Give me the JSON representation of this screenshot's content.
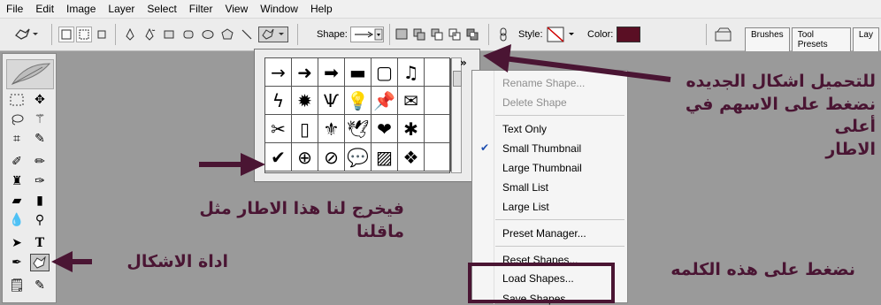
{
  "menubar": {
    "items": [
      "File",
      "Edit",
      "Image",
      "Layer",
      "Select",
      "Filter",
      "View",
      "Window",
      "Help"
    ]
  },
  "options_bar": {
    "shape_label": "Shape:",
    "style_label": "Style:",
    "color_label": "Color:",
    "color_value": "#5a0f24",
    "panel_tabs": [
      "Brushes",
      "Tool Presets",
      "Lay"
    ]
  },
  "shape_picker": {
    "menu_toggle": "»",
    "shapes": [
      [
        "arrow-thin",
        "arrow-medium",
        "arrow-bold",
        "banner",
        "frame-ornate",
        "music-note"
      ],
      [
        "lightning",
        "starburst",
        "grass",
        "lightbulb",
        "pushpin",
        "envelope"
      ],
      [
        "scissors",
        "blank-page",
        "fleur-de-lis",
        "bird",
        "heart",
        "splat"
      ],
      [
        "checkmark",
        "target",
        "no-sign",
        "speech-bubble",
        "hatched-square",
        "diamond-grid"
      ]
    ],
    "glyphs": [
      [
        "→",
        "➜",
        "➡",
        "▬",
        "▢",
        "♫"
      ],
      [
        "ϟ",
        "✹",
        "Ѱ",
        "💡",
        "📌",
        "✉"
      ],
      [
        "✂",
        "▯",
        "⚜",
        "🕊",
        "❤",
        "✱"
      ],
      [
        "✔",
        "⊕",
        "⊘",
        "💬",
        "▨",
        "❖"
      ]
    ]
  },
  "shape_menu": {
    "items": [
      {
        "label": "Rename Shape...",
        "disabled": true,
        "checked": false
      },
      {
        "label": "Delete Shape",
        "disabled": true,
        "checked": false
      },
      {
        "label": "Text Only",
        "disabled": false,
        "checked": false
      },
      {
        "label": "Small Thumbnail",
        "disabled": false,
        "checked": true
      },
      {
        "label": "Large Thumbnail",
        "disabled": false,
        "checked": false
      },
      {
        "label": "Small List",
        "disabled": false,
        "checked": false
      },
      {
        "label": "Large List",
        "disabled": false,
        "checked": false
      },
      {
        "label": "Preset Manager...",
        "disabled": false,
        "checked": false
      },
      {
        "label": "Reset Shapes...",
        "disabled": false,
        "checked": false
      },
      {
        "label": "Load Shapes...",
        "disabled": false,
        "checked": false
      },
      {
        "label": "Save Shapes...",
        "disabled": false,
        "checked": false
      }
    ]
  },
  "annotations": {
    "top_right": "للتحميل اشكال الجديده\nنضغط على الاسهم في أعلى\nالاطار",
    "middle": "فيخرج لنا هذا الاطار مثل ماقلنا",
    "shapes_tool": "اداة الاشكال",
    "load_word": "نضغط على هذه الكلمه"
  },
  "colors": {
    "annotation": "#4a1533",
    "canvas": "#9a9a9a"
  }
}
